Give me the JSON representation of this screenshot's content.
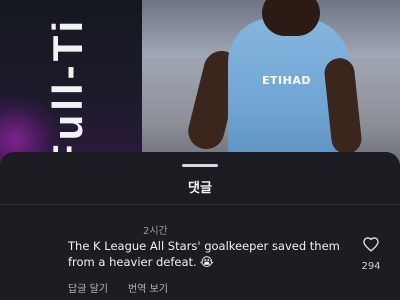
{
  "media": {
    "vertical_text": "Full-Ti",
    "shirt_text": "ETIHAD"
  },
  "comments_sheet": {
    "title": "댓글",
    "comment": {
      "timestamp": "2시간",
      "text": "The K League All Stars' goalkeeper saved them from a heavier defeat.",
      "emoji": "😭",
      "like_count": "294",
      "reply_label": "답글 달기",
      "translate_label": "번역 보기"
    }
  },
  "colors": {
    "sheet_bg": "#1c1c22",
    "text_primary": "#f2f2f2",
    "text_secondary": "#9a9aa2"
  },
  "icons": {
    "like": "heart-outline-icon"
  }
}
